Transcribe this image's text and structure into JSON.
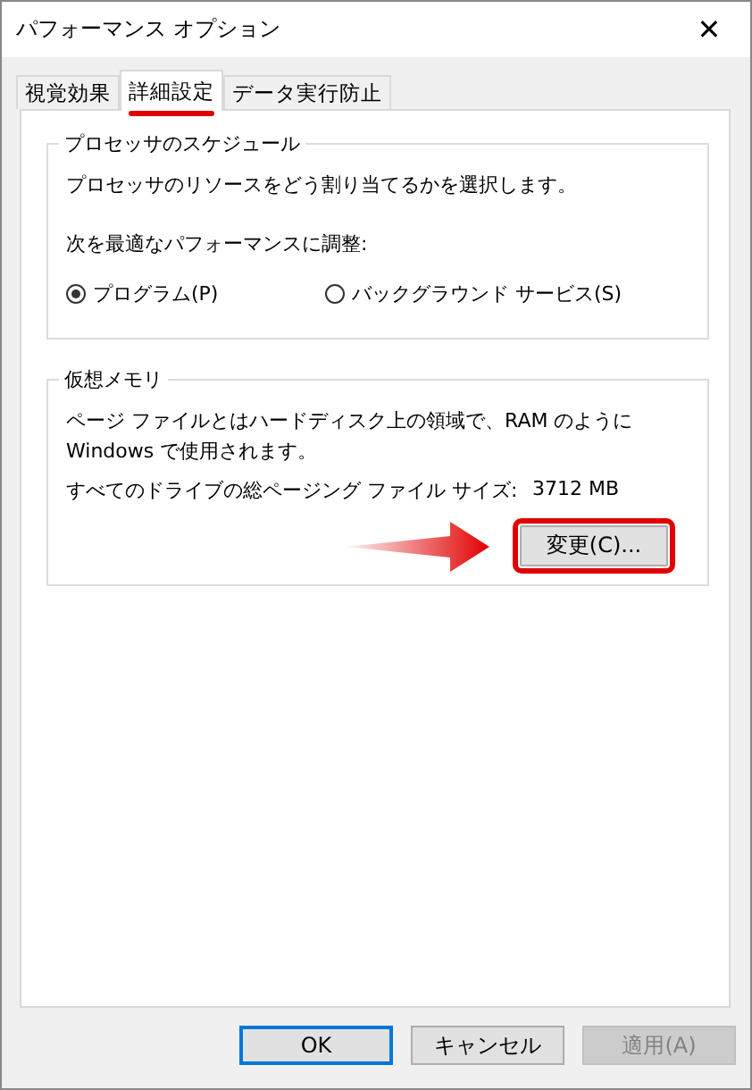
{
  "window": {
    "title": "パフォーマンス オプション",
    "close": "✕"
  },
  "tabs": [
    {
      "label": "視覚効果",
      "selected": false
    },
    {
      "label": "詳細設定",
      "selected": true
    },
    {
      "label": "データ実行防止",
      "selected": false
    }
  ],
  "processor_group": {
    "title": "プロセッサのスケジュール",
    "description": "プロセッサのリソースをどう割り当てるかを選択します。",
    "adjust_label": "次を最適なパフォーマンスに調整:",
    "options": [
      {
        "label": "プログラム(P)",
        "selected": true
      },
      {
        "label": "バックグラウンド サービス(S)",
        "selected": false
      }
    ]
  },
  "memory_group": {
    "title": "仮想メモリ",
    "description": "ページ ファイルとはハードディスク上の領域で、RAM のように Windows で使用されます。",
    "size_label": "すべてのドライブの総ページング ファイル サイズ:",
    "size_value": "3712 MB",
    "change_button": "変更(C)..."
  },
  "buttons": [
    {
      "label": "OK",
      "default": true,
      "disabled": false
    },
    {
      "label": "キャンセル",
      "default": false,
      "disabled": false
    },
    {
      "label": "適用(A)",
      "default": false,
      "disabled": true
    }
  ]
}
